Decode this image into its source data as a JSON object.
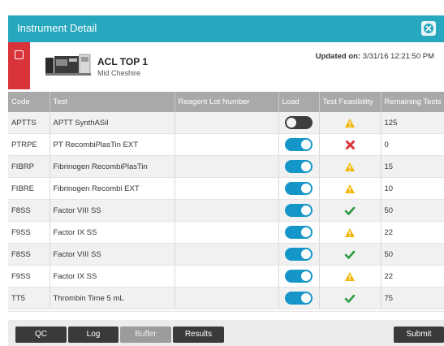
{
  "window": {
    "title": "Instrument Detail"
  },
  "instrument": {
    "name": "ACL TOP 1",
    "site": "Mid Cheshire",
    "updated_label": "Updated on:",
    "updated_value": "3/31/16 12:21:50 PM"
  },
  "table": {
    "headers": [
      "Code",
      "Test",
      "Reagent Lot Number",
      "Load",
      "Test Feasibility",
      "Remaining Tests"
    ],
    "rows": [
      {
        "code": "APTTS",
        "test": "APTT SynthASil",
        "lot": "",
        "load": "off",
        "feasibility": "warning",
        "remaining": "125"
      },
      {
        "code": "PTRPE",
        "test": "PT RecombiPlasTin EXT",
        "lot": "",
        "load": "on",
        "feasibility": "error",
        "remaining": "0"
      },
      {
        "code": "FIBRP",
        "test": "Fibrinogen RecombiPlasTin",
        "lot": "",
        "load": "on",
        "feasibility": "warning",
        "remaining": "15"
      },
      {
        "code": "FIBRE",
        "test": "Fibrinogen Recombi EXT",
        "lot": "",
        "load": "on",
        "feasibility": "warning",
        "remaining": "10"
      },
      {
        "code": "F8SS",
        "test": "Factor VIII SS",
        "lot": "",
        "load": "on",
        "feasibility": "ok",
        "remaining": "50"
      },
      {
        "code": "F9SS",
        "test": "Factor IX SS",
        "lot": "",
        "load": "on",
        "feasibility": "warning",
        "remaining": "22"
      },
      {
        "code": "F8SS",
        "test": "Factor VIII SS",
        "lot": "",
        "load": "on",
        "feasibility": "ok",
        "remaining": "50"
      },
      {
        "code": "F9SS",
        "test": "Factor IX SS",
        "lot": "",
        "load": "on",
        "feasibility": "warning",
        "remaining": "22"
      },
      {
        "code": "TT5",
        "test": "Thrombin Time 5 mL",
        "lot": "",
        "load": "on",
        "feasibility": "ok",
        "remaining": "75"
      }
    ]
  },
  "footer": {
    "qc": "QC",
    "log": "Log",
    "buffer": "Buffer",
    "results": "Results",
    "submit": "Submit"
  },
  "icons": {
    "close": "close-circle-icon",
    "instrument": "instrument-analyzer-icon",
    "warning": "warning-triangle-icon",
    "error": "error-x-icon",
    "ok": "check-icon"
  },
  "colors": {
    "header_teal": "#28a8bf",
    "alert_red": "#d9343a",
    "toggle_on": "#1496c8",
    "toggle_off": "#3d3d3d",
    "warning": "#f2b705",
    "error": "#d9343a",
    "ok": "#2e9a3e"
  }
}
